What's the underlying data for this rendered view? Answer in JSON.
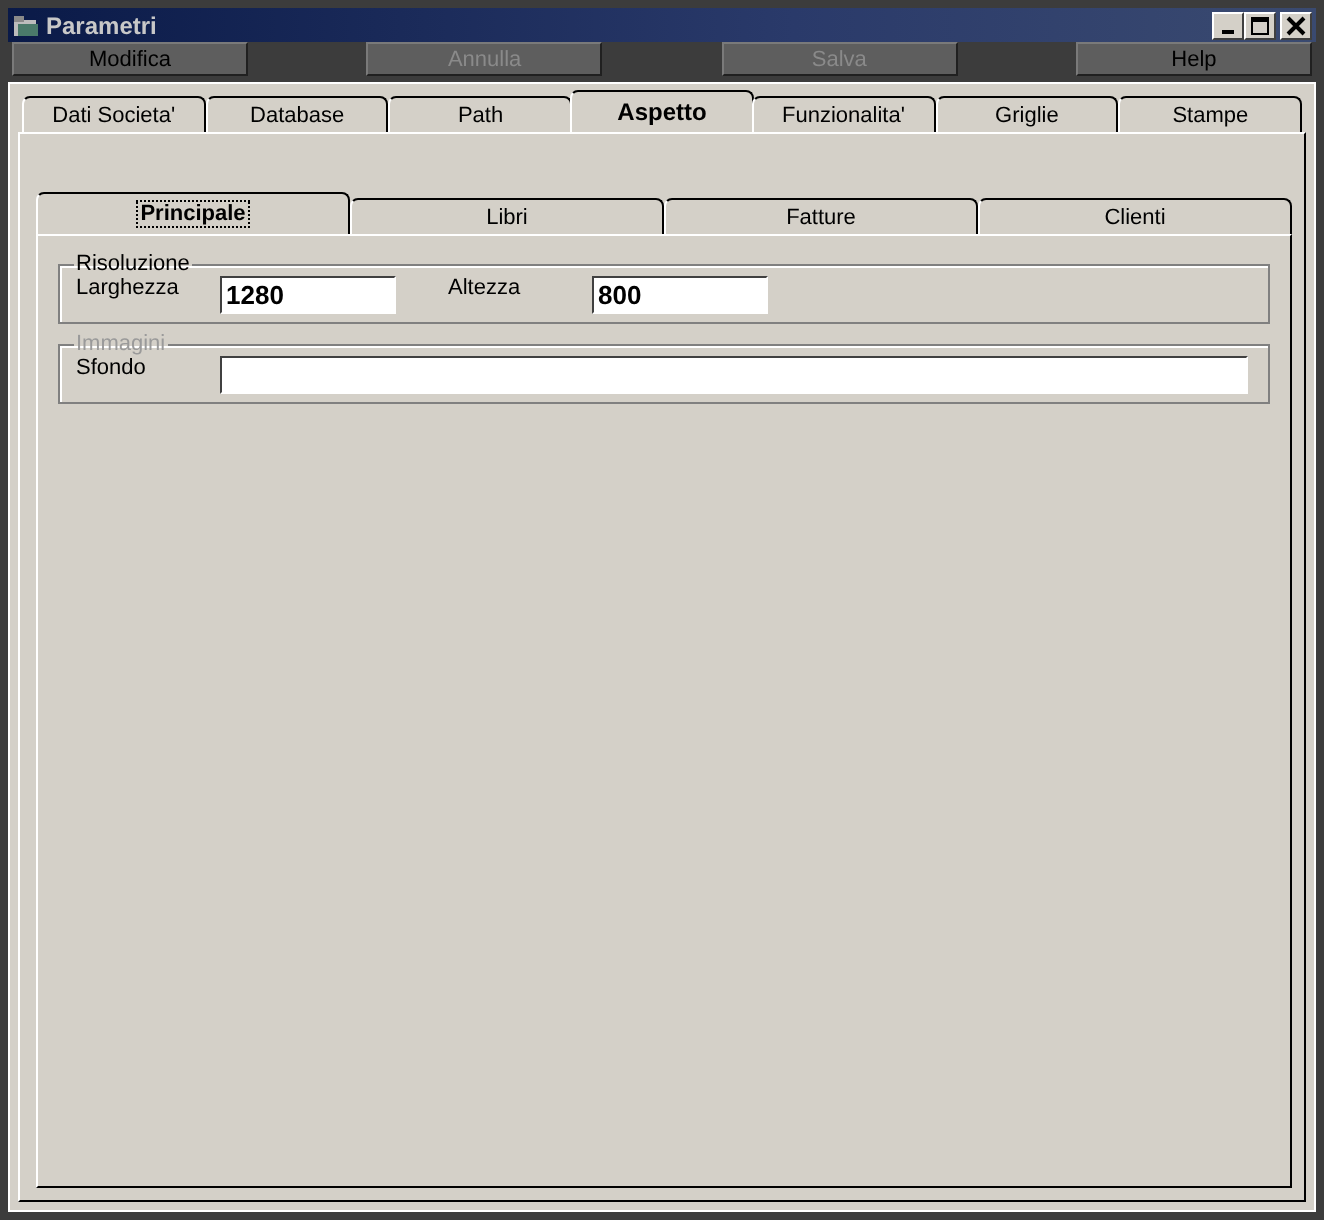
{
  "window": {
    "title": "Parametri"
  },
  "toolbar": [
    {
      "label": "Modifica",
      "disabled": false
    },
    {
      "label": "Annulla",
      "disabled": true
    },
    {
      "label": "Salva",
      "disabled": true
    },
    {
      "label": "Help",
      "disabled": false
    }
  ],
  "tabs": [
    {
      "label": "Dati Societa'",
      "selected": false
    },
    {
      "label": "Database",
      "selected": false
    },
    {
      "label": "Path",
      "selected": false
    },
    {
      "label": "Aspetto",
      "selected": true
    },
    {
      "label": "Funzionalita'",
      "selected": false
    },
    {
      "label": "Griglie",
      "selected": false
    },
    {
      "label": "Stampe",
      "selected": false
    }
  ],
  "subtabs": [
    {
      "label": "Principale",
      "selected": true
    },
    {
      "label": "Libri",
      "selected": false
    },
    {
      "label": "Fatture",
      "selected": false
    },
    {
      "label": "Clienti",
      "selected": false
    }
  ],
  "groups": [
    {
      "title": "Risoluzione",
      "disabled": false,
      "fields": [
        {
          "label": "Larghezza",
          "value": "1280"
        },
        {
          "label": "Altezza",
          "value": "800"
        }
      ]
    },
    {
      "title": "Immagini",
      "disabled": true,
      "fields": [
        {
          "label": "Sfondo",
          "wide": true
        }
      ]
    }
  ]
}
